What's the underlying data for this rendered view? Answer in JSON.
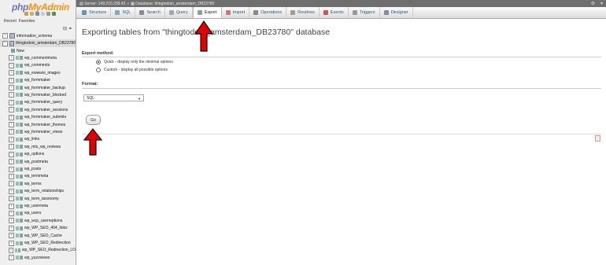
{
  "logo": {
    "php": "php",
    "my": "My",
    "admin": "Admin"
  },
  "sidebar": {
    "recent_label": "Recent",
    "favorites_label": "Favorites",
    "databases": [
      {
        "name": "information_schema"
      },
      {
        "name": "thingtodoin_amsterdam_DB23780"
      }
    ],
    "new_label": "New",
    "tables": [
      "wp_commentmeta",
      "wp_comments",
      "wp_ewwwio_images",
      "wp_formmaker",
      "wp_formmaker_backup",
      "wp_formmaker_blocked",
      "wp_formmaker_query",
      "wp_formmaker_sessions",
      "wp_formmaker_submits",
      "wp_formmaker_themes",
      "wp_formmaker_views",
      "wp_links",
      "wp_mts_wp_reviews",
      "wp_options",
      "wp_postmeta",
      "wp_posts",
      "wp_termmeta",
      "wp_terms",
      "wp_term_relationships",
      "wp_term_taxonomy",
      "wp_usermeta",
      "wp_users",
      "wp_wcp_userreptions",
      "wp_WP_SEO_404_links",
      "wp_WP_SEO_Cache",
      "wp_WP_SEO_Redirection",
      "wp_WP_SEO_Redirection_LO",
      "wp_yuzoviews"
    ]
  },
  "serverbar": {
    "server": "Server: 149.210.209.43",
    "database": "Database: thingtodoin_amsterdam_DB23780"
  },
  "tabs": [
    {
      "label": "Structure",
      "icon": "structure-icon",
      "color": "#6a8fb8"
    },
    {
      "label": "SQL",
      "icon": "sql-icon",
      "color": "#8aa3c0"
    },
    {
      "label": "Search",
      "icon": "search-icon",
      "color": "#889"
    },
    {
      "label": "Query",
      "icon": "query-icon",
      "color": "#9ab"
    },
    {
      "label": "Export",
      "icon": "export-icon",
      "color": "#7a9"
    },
    {
      "label": "Import",
      "icon": "import-icon",
      "color": "#c77"
    },
    {
      "label": "Operations",
      "icon": "wrench-icon",
      "color": "#888"
    },
    {
      "label": "Routines",
      "icon": "routines-icon",
      "color": "#a98"
    },
    {
      "label": "Events",
      "icon": "events-icon",
      "color": "#c55"
    },
    {
      "label": "Triggers",
      "icon": "triggers-icon",
      "color": "#999"
    },
    {
      "label": "Designer",
      "icon": "designer-icon",
      "color": "#88a"
    }
  ],
  "main": {
    "title": "Exporting tables from \"thingtodoin_amsterdam_DB23780\" database",
    "export_method_label": "Export method:",
    "quick_option": "Quick - display only the minimal options",
    "custom_option": "Custom - display all possible options",
    "format_label": "Format:",
    "format_value": "SQL",
    "go_label": "Go"
  },
  "colors": {
    "arrow": "#e00000",
    "sidebar_bg": "#efefef",
    "link": "#235a81"
  }
}
